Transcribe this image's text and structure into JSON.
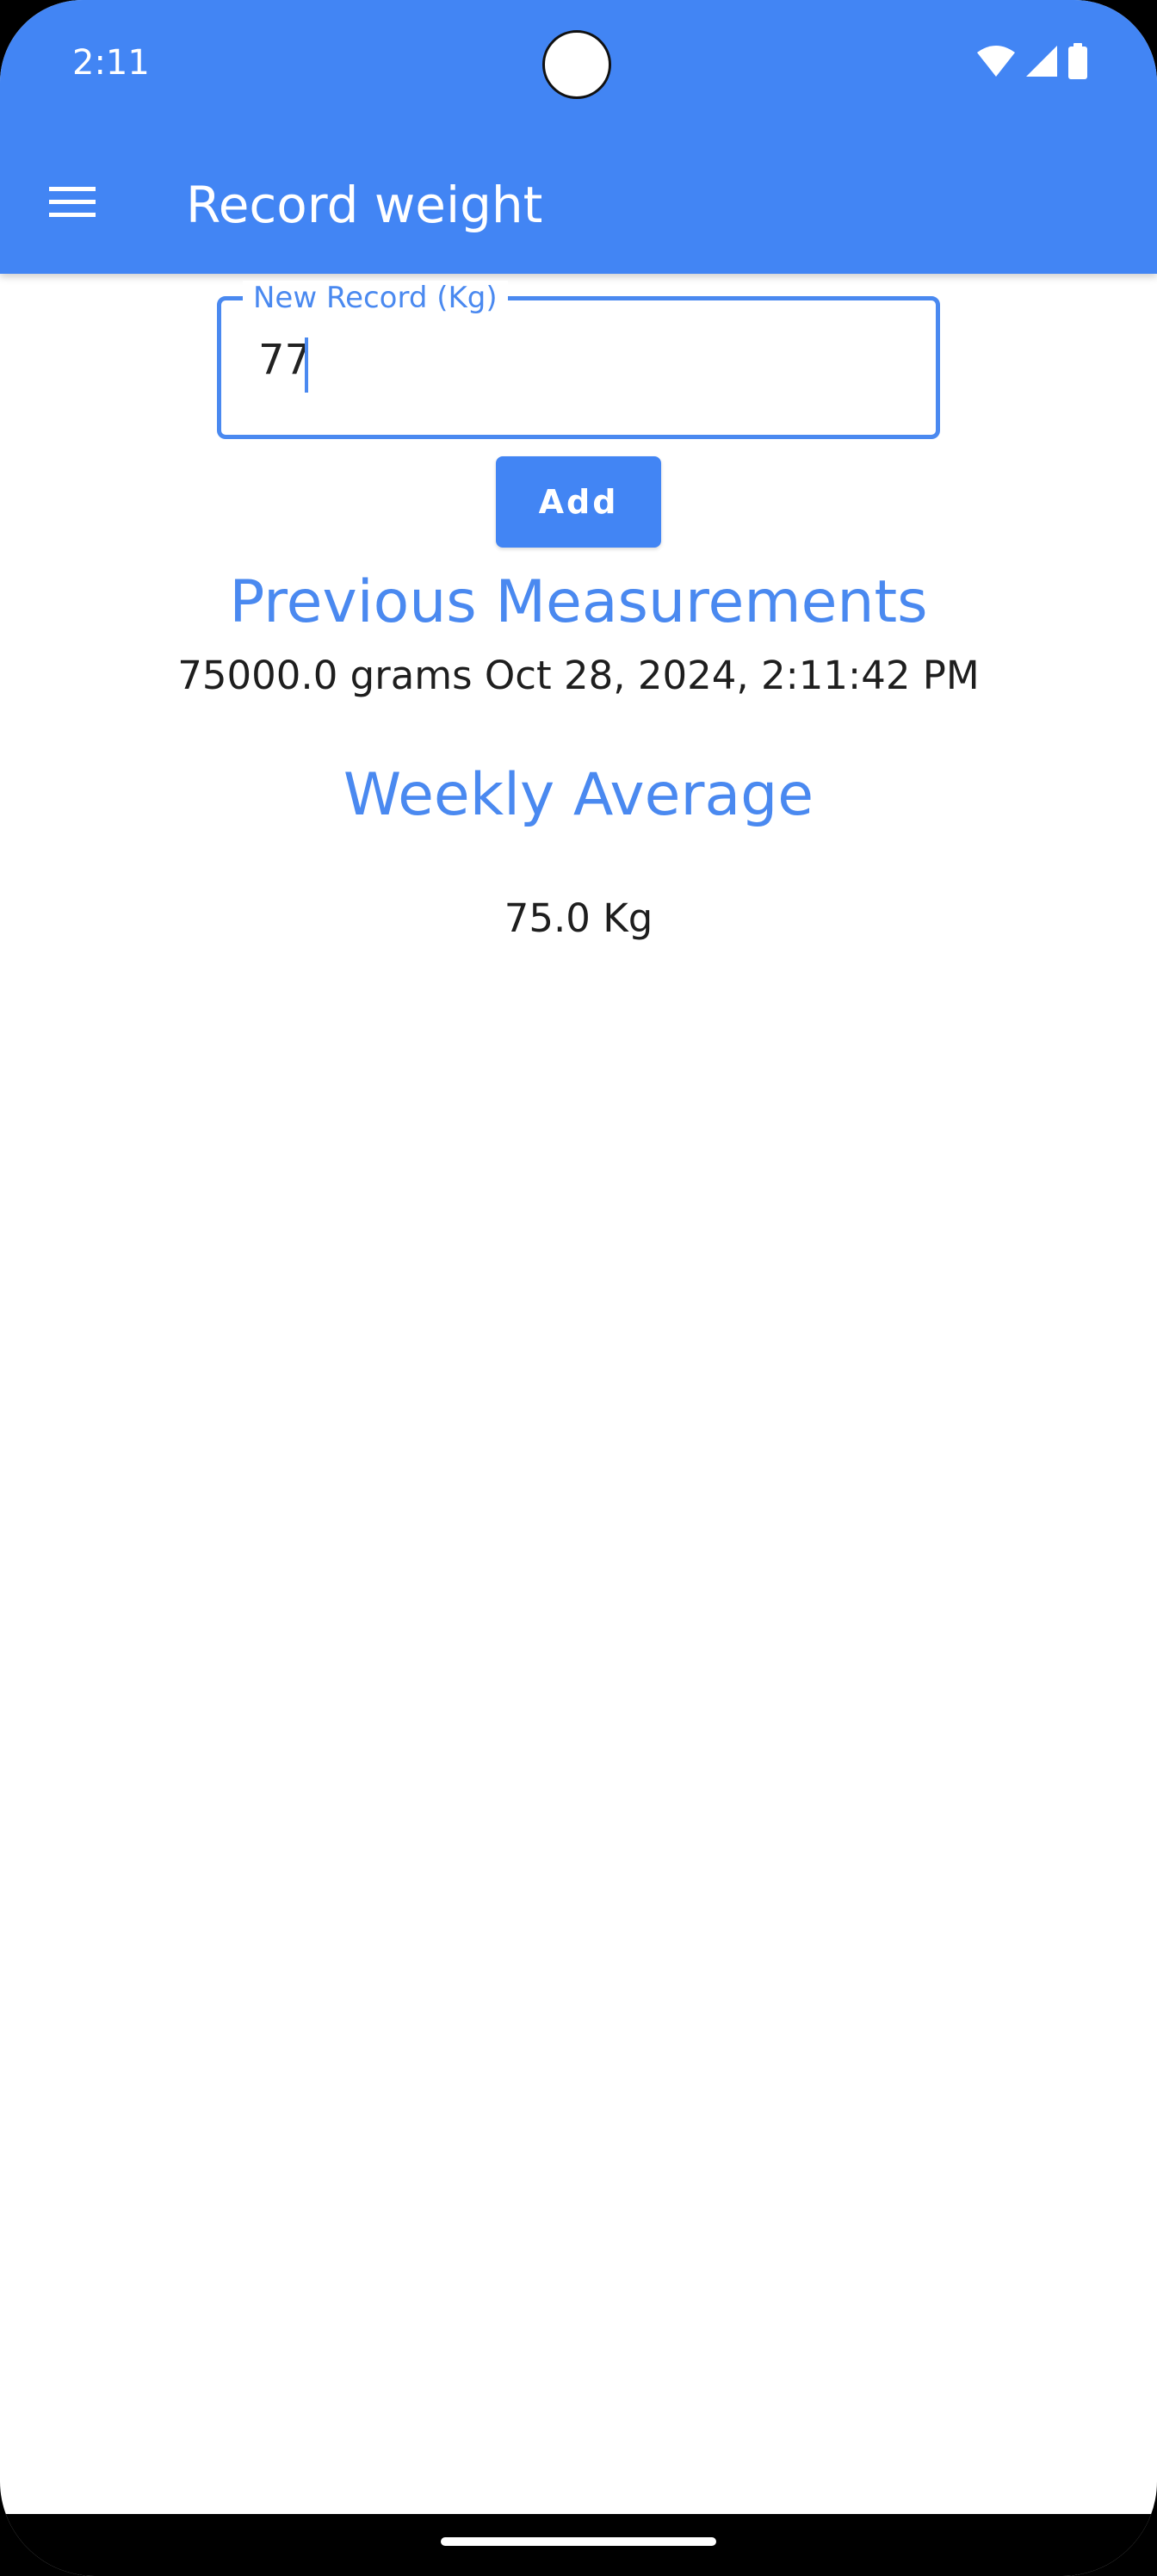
{
  "status_bar": {
    "time": "2:11",
    "icons": [
      "wifi-icon",
      "cellular-signal-icon",
      "battery-icon"
    ]
  },
  "app_bar": {
    "menu_icon": "hamburger-menu-icon",
    "title": "Record weight"
  },
  "form": {
    "field_label": "New Record (Kg)",
    "field_value": "77",
    "add_label": "Add"
  },
  "previous": {
    "heading": "Previous Measurements",
    "entries": [
      "75000.0 grams Oct 28, 2024, 2:11:42 PM"
    ]
  },
  "weekly": {
    "heading": "Weekly Average",
    "value": "75.0 Kg"
  },
  "colors": {
    "primary": "#4285f4",
    "accent_text": "#4a89f0",
    "background": "#ffffff"
  }
}
